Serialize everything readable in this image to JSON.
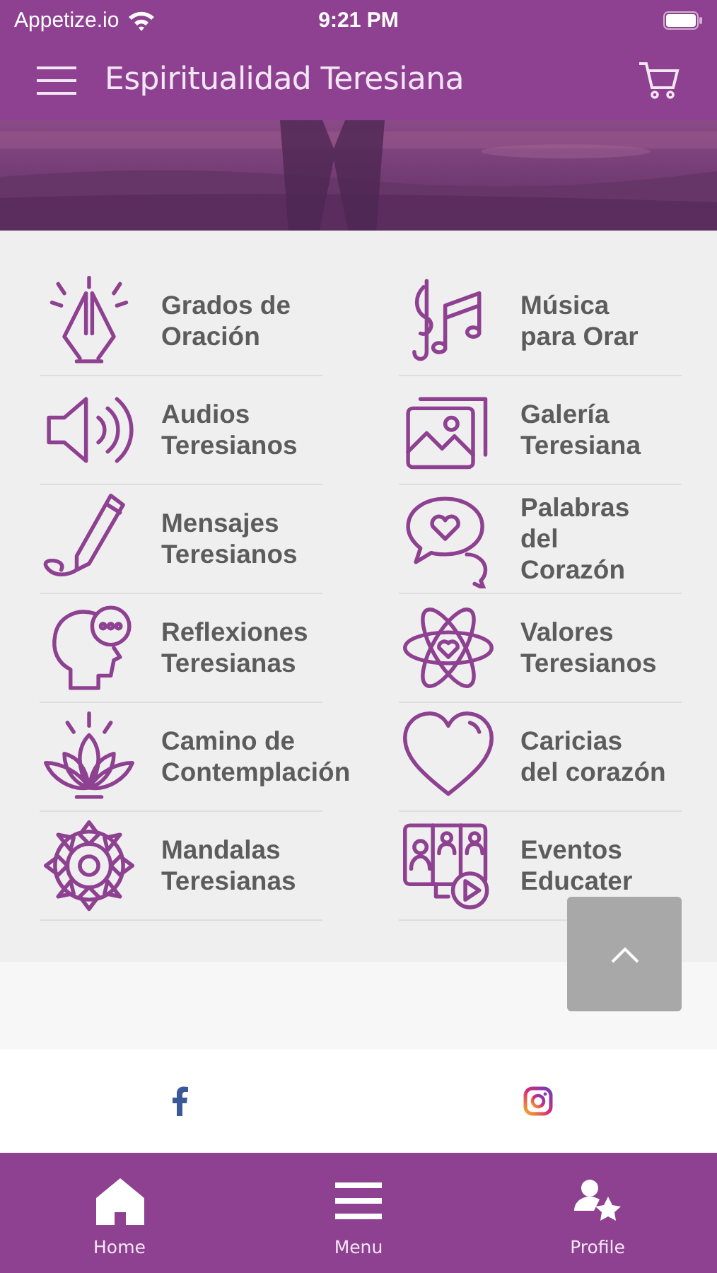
{
  "status_bar": {
    "carrier": "Appetize.io",
    "time": "9:21 PM"
  },
  "header": {
    "title": "Espiritualidad Teresiana"
  },
  "menu": [
    {
      "label": "Grados de\nOración"
    },
    {
      "label": "Música\npara Orar"
    },
    {
      "label": "Audios\nTeresianos"
    },
    {
      "label": "Galería\nTeresiana"
    },
    {
      "label": "Mensajes\nTeresianos"
    },
    {
      "label": "Palabras\ndel\nCorazón"
    },
    {
      "label": "Reflexiones\nTeresianas"
    },
    {
      "label": "Valores\nTeresianos"
    },
    {
      "label": "Camino de\nContemplación"
    },
    {
      "label": "Caricias\ndel corazón"
    },
    {
      "label": "Mandalas\nTeresianas"
    },
    {
      "label": "Eventos\nEducater"
    }
  ],
  "tab_bar": [
    {
      "label": "Home"
    },
    {
      "label": "Menu"
    },
    {
      "label": "Profile"
    }
  ]
}
